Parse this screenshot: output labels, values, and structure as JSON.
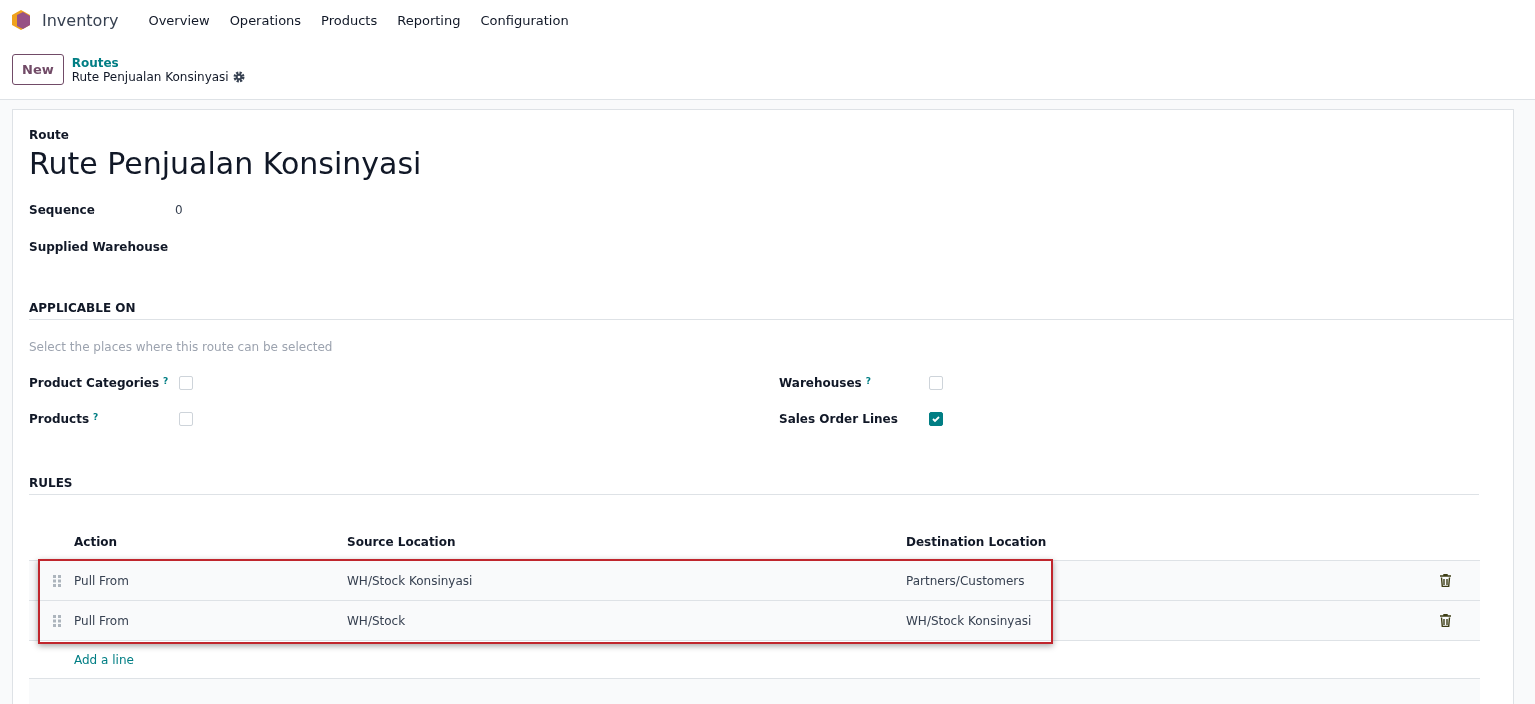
{
  "app": {
    "name": "Inventory",
    "menu": [
      "Overview",
      "Operations",
      "Products",
      "Reporting",
      "Configuration"
    ]
  },
  "control_panel": {
    "new_button": "New",
    "breadcrumb": "Routes",
    "record": "Rute Penjualan Konsinyasi"
  },
  "form": {
    "route_label": "Route",
    "route_name": "Rute Penjualan Konsinyasi",
    "fields": [
      {
        "label": "Sequence",
        "value": "0"
      },
      {
        "label": "Supplied Warehouse"
      }
    ],
    "applicable_on": {
      "title": "APPLICABLE ON",
      "hint": "Select the places where this route can be selected",
      "options": [
        {
          "label": "Product Categories",
          "help": "?",
          "checked": false
        },
        {
          "label": "Warehouses",
          "help": "?",
          "checked": false
        },
        {
          "label": "Products",
          "help": "?",
          "checked": false
        },
        {
          "label": "Sales Order Lines",
          "checked": true
        }
      ]
    },
    "rules": {
      "title": "RULES",
      "columns": [
        "Action",
        "Source Location",
        "Destination Location"
      ],
      "rows": [
        {
          "cells": [
            "Pull From",
            "WH/Stock Konsinyasi",
            "Partners/Customers"
          ]
        },
        {
          "cells": [
            "Pull From",
            "WH/Stock",
            "WH/Stock Konsinyasi"
          ]
        }
      ],
      "add_line": "Add a line"
    }
  }
}
